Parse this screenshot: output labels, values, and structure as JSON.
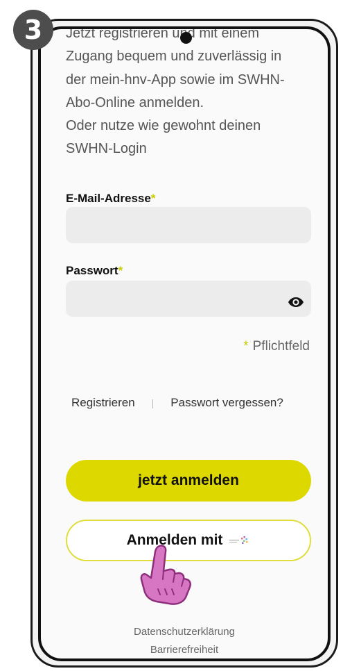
{
  "step_badge": "3",
  "intro": {
    "lines": [
      "Jetzt registrieren und mit einem",
      "Zugang bequem und zuverlässig in",
      "der mein-hnv-App sowie im SWHN-",
      "Abo-Online anmelden.",
      "Oder nutze wie gewohnt deinen",
      "SWHN-Login"
    ]
  },
  "form": {
    "email_label": "E-Mail-Adresse",
    "email_value": "",
    "password_label": "Passwort",
    "password_value": "",
    "required_marker": "*",
    "required_note": "Pflichtfeld"
  },
  "links": {
    "register": "Registrieren",
    "separator": "|",
    "forgot_password": "Passwort vergessen?"
  },
  "buttons": {
    "login": "jetzt anmelden",
    "login_with": "Anmelden mit"
  },
  "footer": {
    "privacy": "Datenschutzerklärung",
    "accessibility": "Barrierefreiheit"
  },
  "icons": {
    "eye": "eye-icon",
    "provider_logo": "provider-logo-icon",
    "hand": "pointing-hand-icon"
  },
  "colors": {
    "accent": "#dcd800",
    "accent_border": "#e0dd3c",
    "required": "#c8cc00",
    "hand": "#d776c2"
  }
}
